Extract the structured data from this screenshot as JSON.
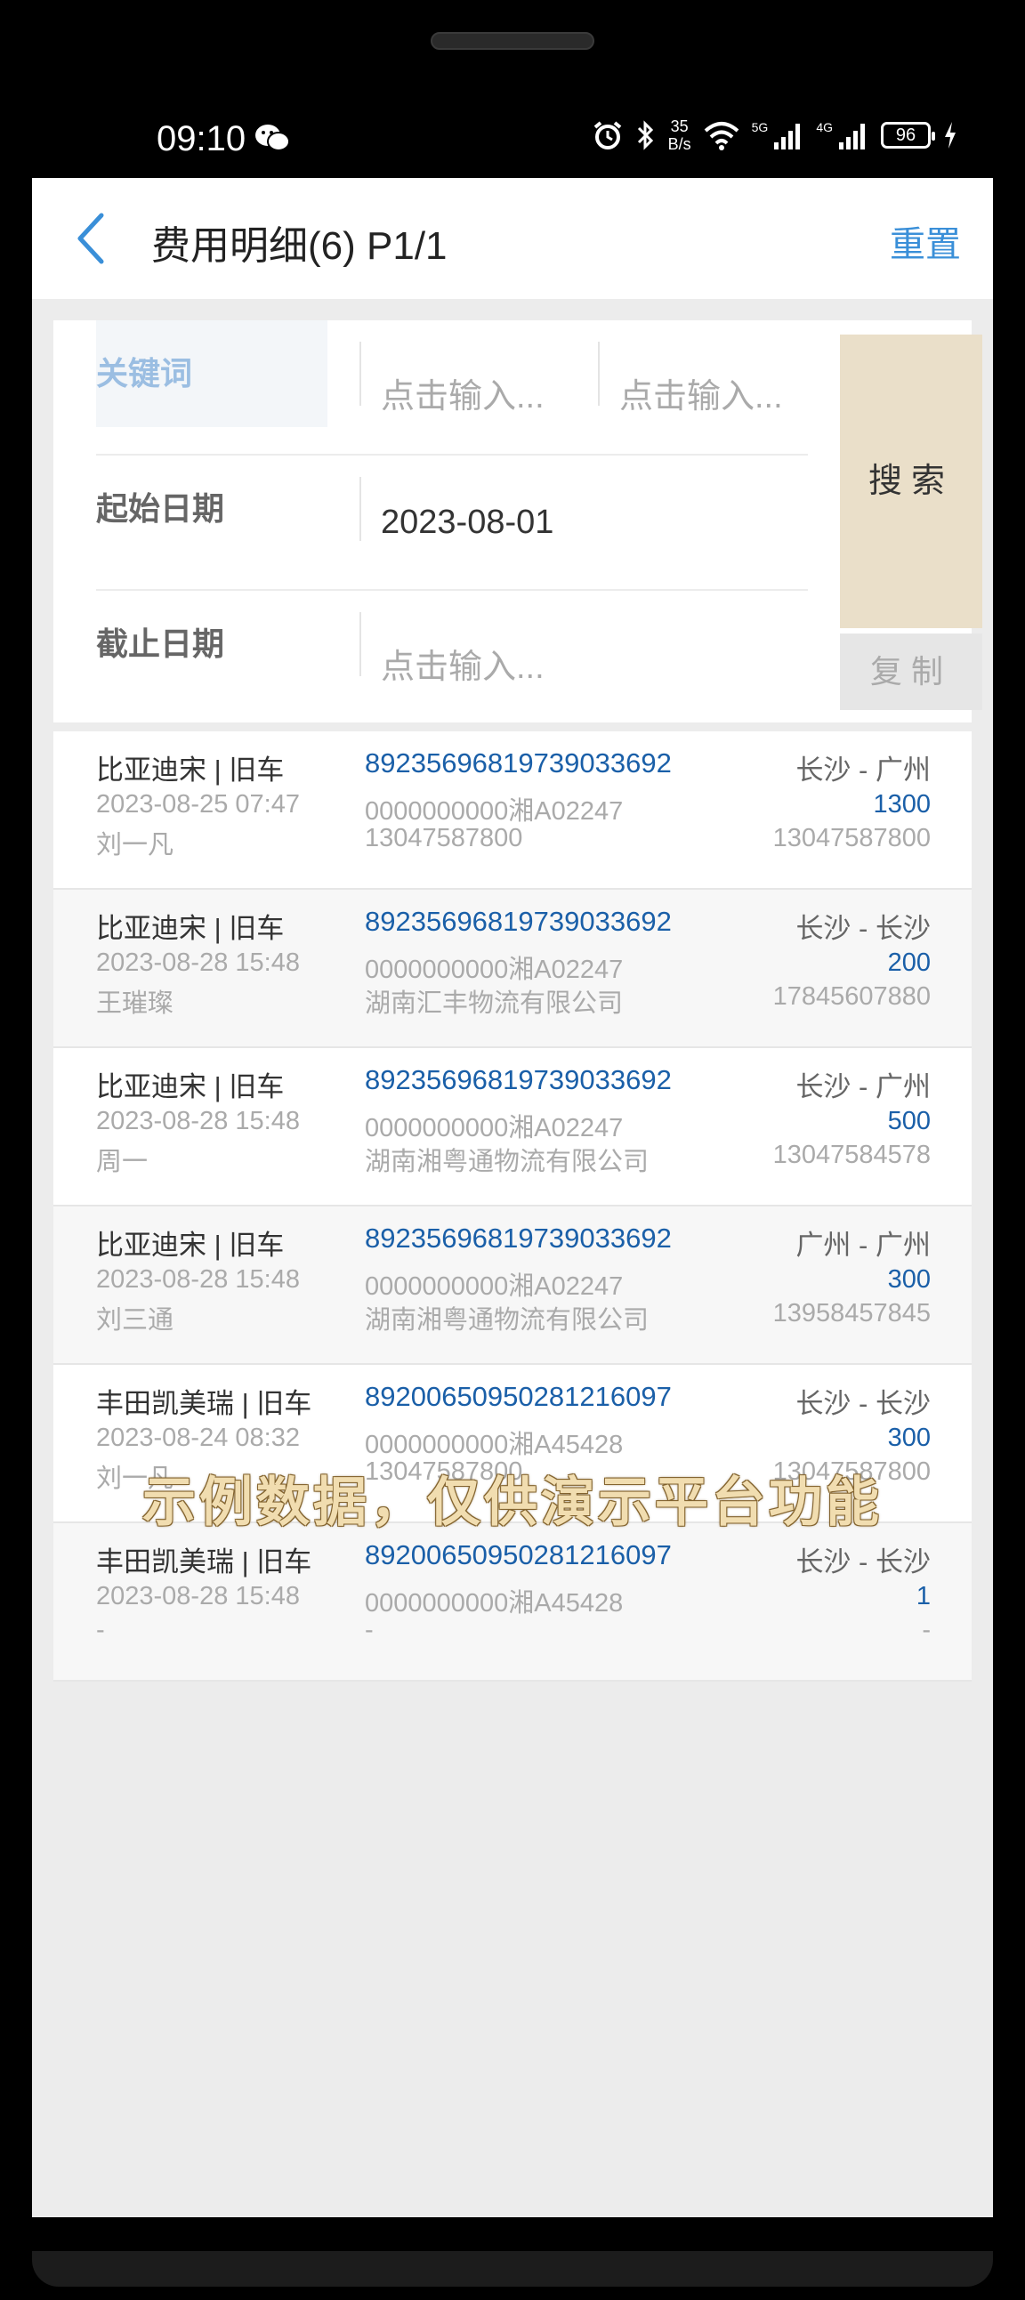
{
  "status_bar": {
    "time": "09:10",
    "net_speed_value": "35",
    "net_speed_unit": "B/s",
    "sig1_label": "5G",
    "sig2_label": "4G",
    "battery": "96"
  },
  "nav": {
    "title": "费用明细(6) P1/1",
    "reset": "重置"
  },
  "search": {
    "keyword_label": "关键词",
    "keyword_placeholder_1": "点击输入...",
    "keyword_placeholder_2": "点击输入...",
    "start_label": "起始日期",
    "start_value": "2023-08-01",
    "end_label": "截止日期",
    "end_placeholder": "点击输入...",
    "search_button": "搜索",
    "copy_button": "复制"
  },
  "items": [
    {
      "car": "比亚迪宋 | 旧车",
      "date": "2023-08-25 07:47",
      "person": "刘一凡",
      "card": "89235696819739033692",
      "plate": "0000000000湘A02247",
      "company": "13047587800",
      "route": "长沙 - 广州",
      "amount": "1300",
      "phone": "13047587800"
    },
    {
      "car": "比亚迪宋 | 旧车",
      "date": "2023-08-28 15:48",
      "person": "王璀璨",
      "card": "89235696819739033692",
      "plate": "0000000000湘A02247",
      "company": "湖南汇丰物流有限公司",
      "route": "长沙 - 长沙",
      "amount": "200",
      "phone": "17845607880"
    },
    {
      "car": "比亚迪宋 | 旧车",
      "date": "2023-08-28 15:48",
      "person": "周一",
      "card": "89235696819739033692",
      "plate": "0000000000湘A02247",
      "company": "湖南湘粤通物流有限公司",
      "route": "长沙 - 广州",
      "amount": "500",
      "phone": "13047584578"
    },
    {
      "car": "比亚迪宋 | 旧车",
      "date": "2023-08-28 15:48",
      "person": "刘三通",
      "card": "89235696819739033692",
      "plate": "0000000000湘A02247",
      "company": "湖南湘粤通物流有限公司",
      "route": "广州 - 广州",
      "amount": "300",
      "phone": "13958457845"
    },
    {
      "car": "丰田凯美瑞 | 旧车",
      "date": "2023-08-24 08:32",
      "person": "刘一凡",
      "card": "89200650950281216097",
      "plate": "0000000000湘A45428",
      "company": "13047587800",
      "route": "长沙 - 长沙",
      "amount": "300",
      "phone": "13047587800"
    },
    {
      "car": "丰田凯美瑞 | 旧车",
      "date": "2023-08-28 15:48",
      "person": "-",
      "card": "89200650950281216097",
      "plate": "0000000000湘A45428",
      "company": "-",
      "route": "长沙 - 长沙",
      "amount": "1",
      "phone": "-"
    }
  ],
  "watermark": "示例数据，仅供演示平台功能",
  "colors": {
    "accent_blue": "#3a8fd8",
    "link_blue": "#1a5fa8",
    "search_button_bg": "#eadfc9"
  }
}
